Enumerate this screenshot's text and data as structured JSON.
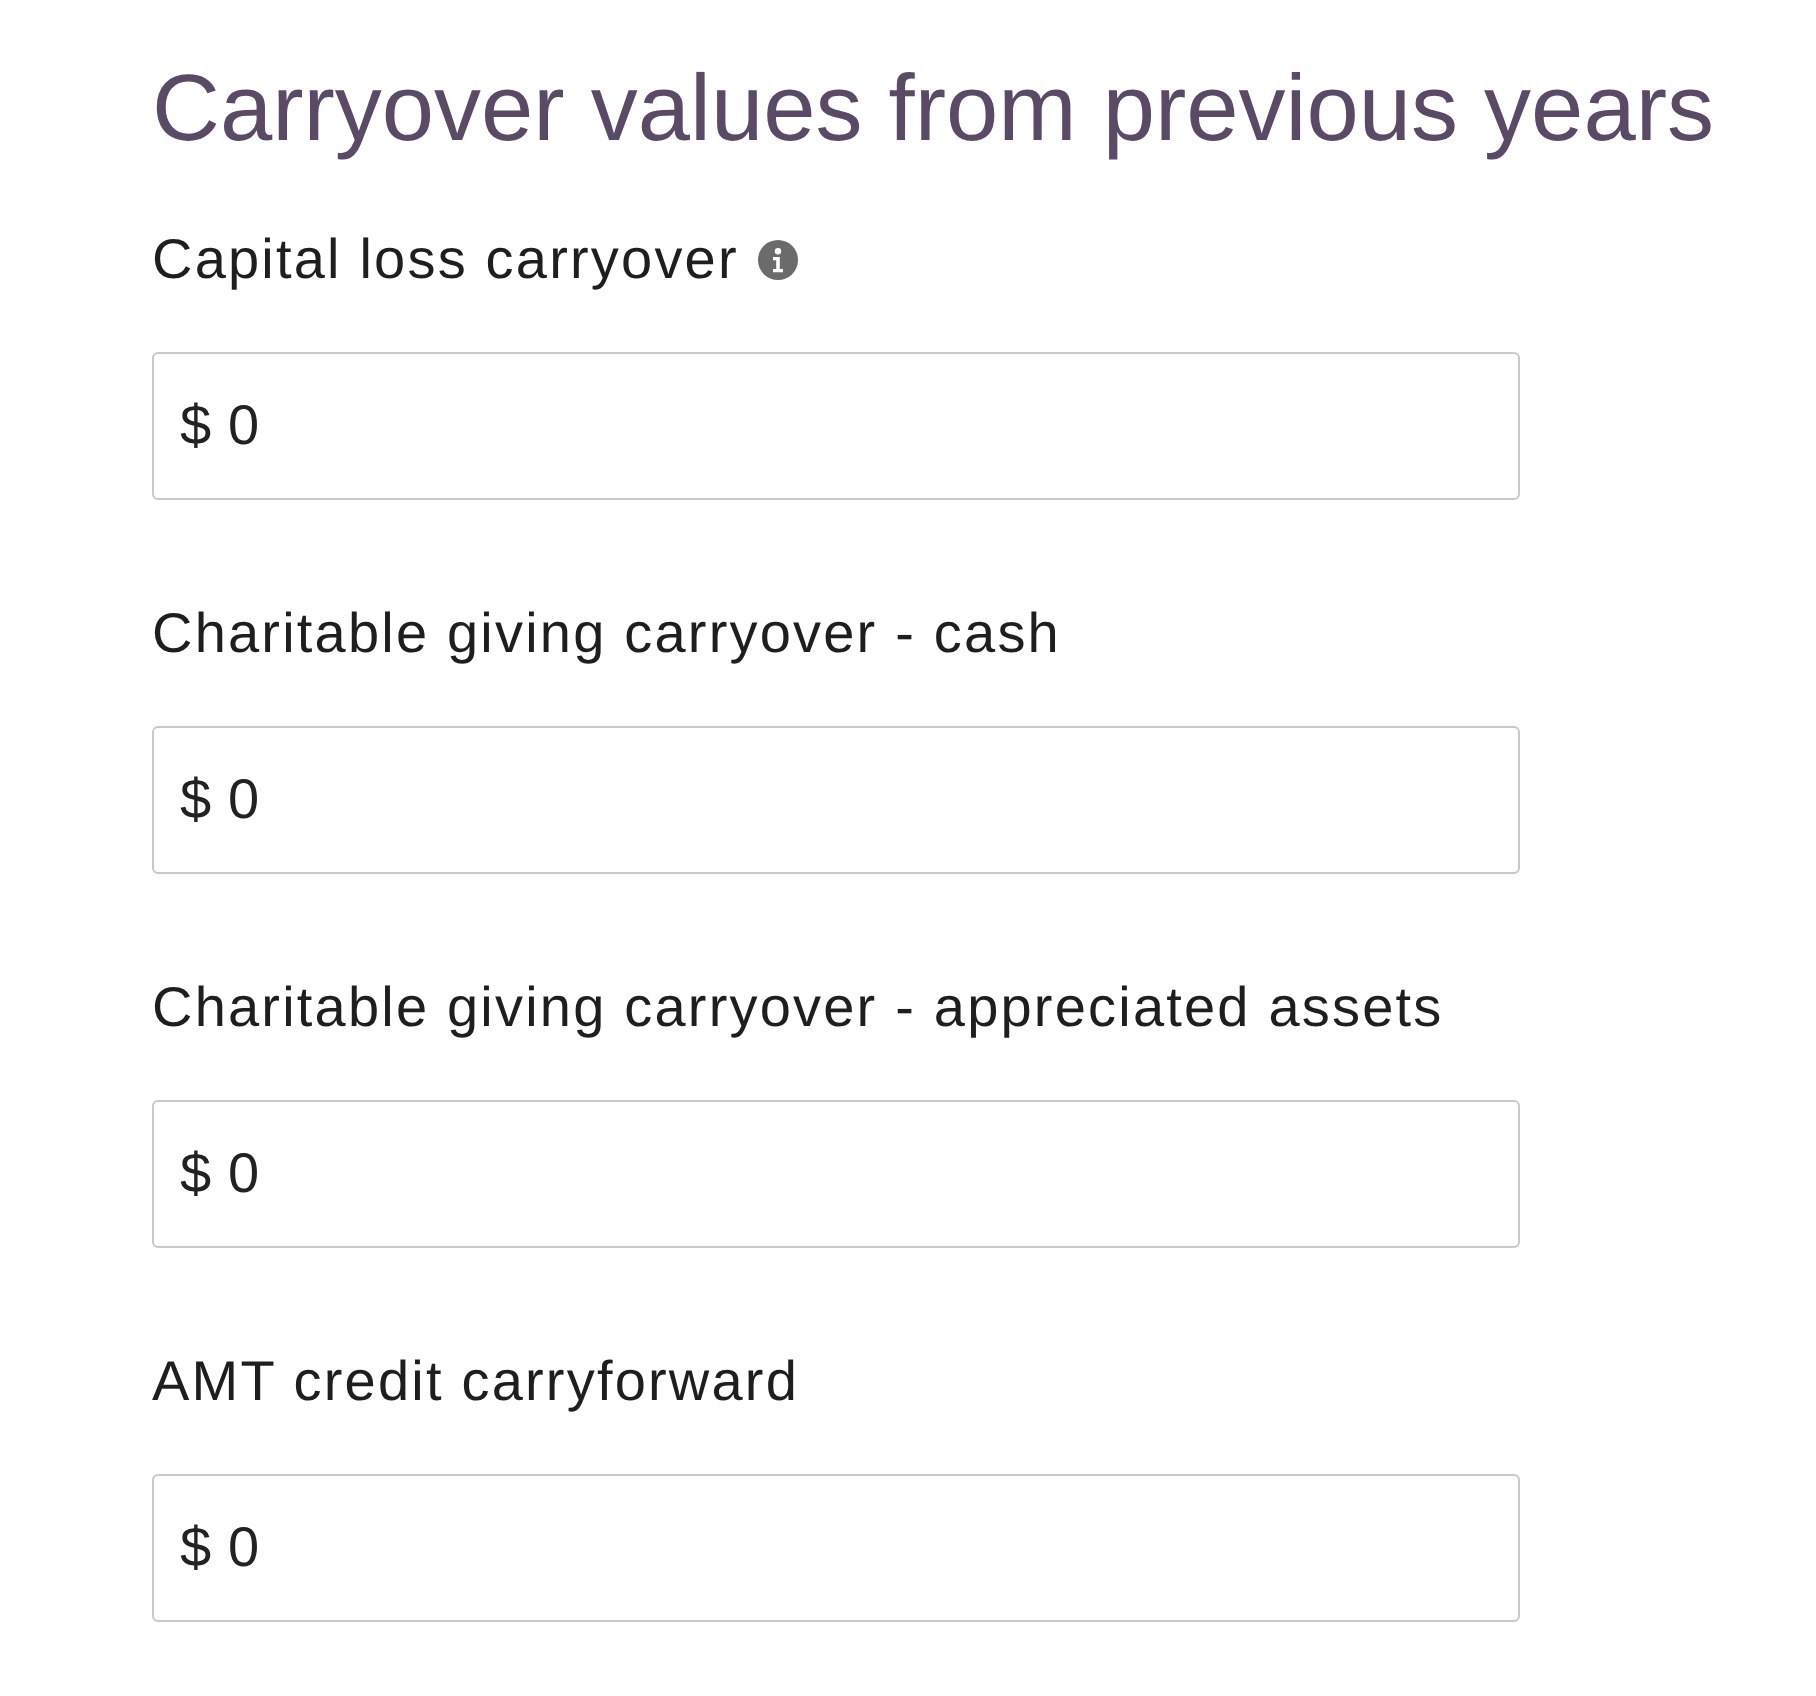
{
  "title": "Carryover values from previous years",
  "fields": [
    {
      "label": "Capital loss carryover",
      "info": true,
      "prefix": "$",
      "value": "0"
    },
    {
      "label": "Charitable giving carryover - cash",
      "info": false,
      "prefix": "$",
      "value": "0"
    },
    {
      "label": "Charitable giving carryover - appreciated assets",
      "info": false,
      "prefix": "$",
      "value": "0"
    },
    {
      "label": "AMT credit carryforward",
      "info": false,
      "prefix": "$",
      "value": "0"
    }
  ]
}
